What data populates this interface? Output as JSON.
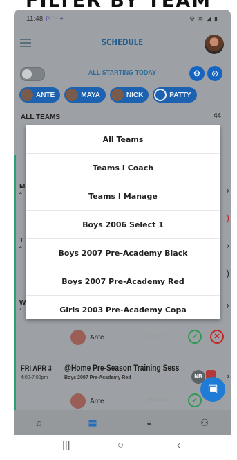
{
  "header_banner": "FILTER BY TEAM",
  "statusbar": {
    "time": "11:48",
    "status_icons": "P ⚐ ✦ ···",
    "right_icons": "⚙ ≋ ◢ ▮"
  },
  "topbar": {
    "title": "SCHEDULE"
  },
  "toolbar": {
    "filter_label": "ALL STARTING TODAY"
  },
  "chips": [
    {
      "label": "ANTE"
    },
    {
      "label": "MAYA"
    },
    {
      "label": "NICK"
    },
    {
      "label": "PATTY"
    }
  ],
  "behind": {
    "section_label": "ALL TEAMS",
    "count": "44"
  },
  "dropdown": {
    "options": [
      "All Teams",
      "Teams I Coach",
      "Teams I Manage",
      "Boys 2006 Select 1",
      "Boys 2007 Pre-Academy Black",
      "Boys 2007 Pre-Academy Red",
      "Girls 2003 Pre-Academy Copa"
    ]
  },
  "rows": [
    {
      "member": "Ante",
      "attendance": "Attendance"
    },
    {
      "member": "Ante",
      "attendance": "Attendance"
    }
  ],
  "event": {
    "date": "FRI APR 3",
    "time": "4:00-7:00pm",
    "title": "@Home Pre-Season Training Sess",
    "team": "Boys 2007 Pre-Academy Red",
    "badge": "NB"
  },
  "side_letters": [
    "M",
    "4",
    "T",
    "4",
    "W",
    "4"
  ]
}
